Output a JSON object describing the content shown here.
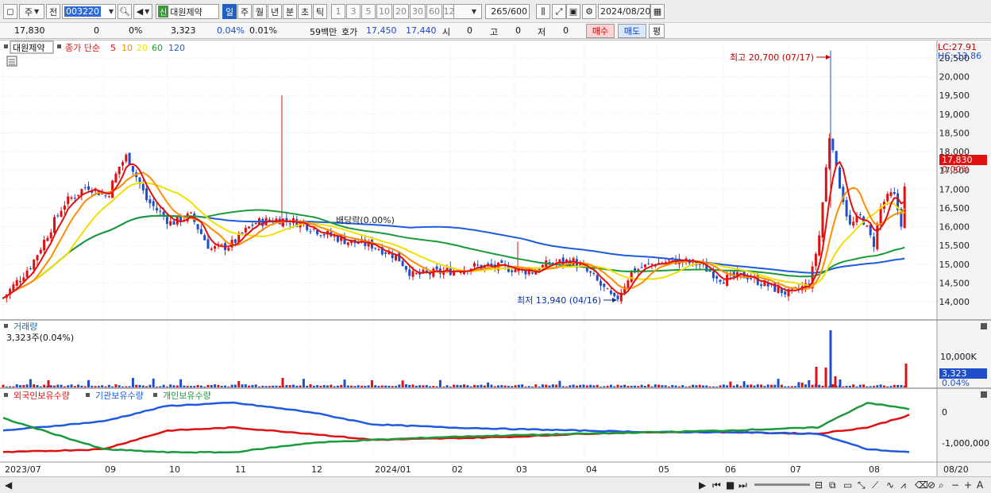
{
  "toolbar": {
    "market_type": "주",
    "prev_label": "전",
    "stock_code": "003220",
    "stock_tag": "신",
    "stock_name": "대원제약",
    "periods": [
      "일",
      "주",
      "월",
      "년",
      "분",
      "초",
      "틱"
    ],
    "active_period": "일",
    "intervals": [
      "1",
      "3",
      "5",
      "10",
      "20",
      "30",
      "60",
      "120"
    ],
    "count_current": "265",
    "count_total": "/600",
    "date": "2024/08/20"
  },
  "quote": {
    "price": "17,830",
    "change": "0",
    "change_pct": "0%",
    "volume": "3,323",
    "volume_pct": "0.04%",
    "turnover_pct": "0.01%",
    "amount": "59백만",
    "hoga_label": "호가",
    "ask": "17,450",
    "bid": "17,440",
    "open_label": "시",
    "open": "0",
    "high_label": "고",
    "high": "0",
    "low_label": "저",
    "low": "0",
    "buy_label": "매수",
    "sell_label": "매도",
    "avg_label": "평"
  },
  "price_panel": {
    "stock_label": "대원제약",
    "ma_prefix": "종가 단순",
    "ma_periods": [
      {
        "label": "5",
        "color": "#e01010"
      },
      {
        "label": "10",
        "color": "#ff8c00"
      },
      {
        "label": "20",
        "color": "#f0e000"
      },
      {
        "label": "60",
        "color": "#1a9a3a"
      },
      {
        "label": "120",
        "color": "#1e5ae0"
      }
    ],
    "high_annotation": "최고 20,700 (07/17)",
    "low_annotation": "최저 13,940 (04/16)",
    "dividend_annotation": "배당락(0.00%)",
    "lc_label": "LC:27.91",
    "hc_label": "HC:-13.86",
    "current_price_tag": "17,830",
    "current_pct_tag": "0.00%",
    "y_ticks": [
      "20,500",
      "20,000",
      "19,500",
      "19,000",
      "18,500",
      "18,000",
      "17,500",
      "17,000",
      "16,500",
      "16,000",
      "15,500",
      "15,000",
      "14,500",
      "14,000"
    ]
  },
  "volume_panel": {
    "title": "거래량",
    "value_label": "3,323주(0.04%)",
    "y_tick": "10,000K",
    "current_tag": "3,323",
    "current_pct_tag": "0.04%"
  },
  "holdings_panel": {
    "series_labels": [
      {
        "label": "외국인보유수량",
        "color": "#e01010"
      },
      {
        "label": "기관보유수량",
        "color": "#1e5ae0"
      },
      {
        "label": "개인보유수량",
        "color": "#1a9a3a"
      }
    ],
    "y_ticks": [
      "0",
      "-1,000,000"
    ]
  },
  "x_axis": {
    "labels": [
      "2023/07",
      "09",
      "10",
      "11",
      "12",
      "2024/01",
      "02",
      "03",
      "04",
      "05",
      "06",
      "07",
      "08",
      "08/20"
    ]
  },
  "colors": {
    "up": "#e01010",
    "down": "#1e4fc8",
    "ma5": "#e01010",
    "ma10": "#ff8c00",
    "ma20": "#f0e000",
    "ma60": "#1a9a3a",
    "ma120": "#1e5ae0"
  },
  "chart_data": {
    "type": "line",
    "title": "대원제약",
    "dates": [
      "2023/07",
      "09",
      "10",
      "11",
      "12",
      "2024/01",
      "02",
      "03",
      "04",
      "05",
      "06",
      "07",
      "08",
      "08/20"
    ],
    "ylim": [
      13800,
      20700
    ],
    "series": [
      {
        "name": "종가",
        "values": [
          14100,
          17300,
          15600,
          16500,
          16200,
          15300,
          14800,
          14900,
          14000,
          15200,
          14600,
          16000,
          16300,
          17830
        ]
      },
      {
        "name": "5",
        "values": [
          14000,
          17800,
          15900,
          16300,
          16300,
          15400,
          14800,
          14850,
          14000,
          15100,
          14600,
          16200,
          16000,
          16900
        ]
      },
      {
        "name": "10",
        "values": [
          14100,
          17500,
          16000,
          16100,
          16400,
          15500,
          14900,
          14900,
          14200,
          15000,
          14600,
          16000,
          15900,
          16500
        ]
      },
      {
        "name": "20",
        "values": [
          14000,
          17000,
          16200,
          16000,
          16300,
          15500,
          15000,
          14900,
          14500,
          14900,
          14700,
          15300,
          15700,
          16200
        ]
      },
      {
        "name": "60",
        "values": [
          14300,
          15000,
          15900,
          16300,
          16200,
          15900,
          15300,
          15000,
          14800,
          14900,
          14800,
          14800,
          15000,
          15200
        ]
      },
      {
        "name": "120",
        "values": [
          14700,
          14700,
          15200,
          15500,
          15800,
          16000,
          15800,
          15400,
          15100,
          15000,
          14900,
          14700,
          14900,
          15050
        ]
      }
    ],
    "volume": {
      "highlights": [
        {
          "date": "07/17",
          "value": 17000
        },
        {
          "date": "08/20",
          "value": 3323
        }
      ]
    },
    "holdings": [
      {
        "name": "외국인보유수량",
        "values": [
          -1300000,
          -1200000,
          -600000,
          -500000,
          -700000,
          -900000,
          -850000,
          -800000,
          -700000,
          -650000,
          -650000,
          -700000,
          -500000,
          -100000
        ]
      },
      {
        "name": "기관보유수량",
        "values": [
          -600000,
          -300000,
          200000,
          300000,
          0,
          -400000,
          -500000,
          -550000,
          -600000,
          -650000,
          -650000,
          -700000,
          -1200000,
          -1300000
        ]
      },
      {
        "name": "개인보유수량",
        "values": [
          -200000,
          -1200000,
          -1300000,
          -1300000,
          -1000000,
          -900000,
          -800000,
          -750000,
          -700000,
          -650000,
          -600000,
          -500000,
          300000,
          100000
        ]
      }
    ]
  }
}
